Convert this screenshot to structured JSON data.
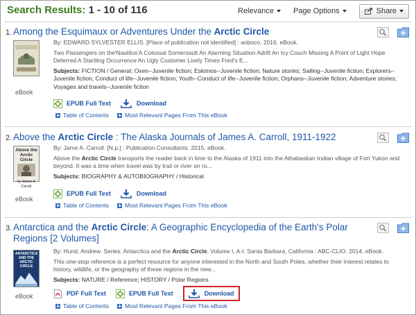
{
  "header": {
    "title_prefix": "Search Results:",
    "title_count": "1 - 10 of 116",
    "relevance_label": "Relevance",
    "page_options_label": "Page Options",
    "share_label": "Share"
  },
  "results": [
    {
      "number": "1.",
      "title_before": "Among the Esquimaux or Adventures Under the ",
      "title_bold": "Arctic Circle",
      "title_after": "",
      "byline": "By: EDWARD SYLVESTER ELLIS. [Place of publication not identified] : anboco. 2016. eBook.",
      "description": "Two Passengers on the'Nautilus'A Colossal Somersault An Alarming Situation Adrift An Icy Couch Missing A Point of Light Hope Deferred A Startling Occurrence An Ugly Customer Lively Times Fred's E...",
      "description_bold": "",
      "description_after": "",
      "subjects_label": "Subjects:",
      "subjects": "FICTION / General; Oxen--Juvenile fiction; Eskimos--Juvenile fiction; Nature stories; Sailing--Juvenile fiction; Explorers--Juvenile fiction; Conduct of life--Juvenile fiction; Youth--Conduct of life--Juvenile fiction; Orphans--Juvenile fiction; Adventure stories; Voyages and travels--Juvenile fiction",
      "cover_label": "eBook",
      "links": [
        "EPUB Full Text",
        "Download"
      ],
      "toc": [
        "Table of Contents",
        "Most Relevant Pages From This eBook"
      ]
    },
    {
      "number": "2.",
      "title_before": "Above the ",
      "title_bold": "Arctic Circle",
      "title_after": " : The Alaska Journals of James A. Carroll, 1911-1922",
      "byline": "By: Jame A. Carroll. [N.p.] : Publication Consultants. 2015. eBook.",
      "description": "Above the ",
      "description_bold": "Arctic Circle",
      "description_after": " transports the reader back in time to the Alaska of 1911 into the Athabaskan Indian village of Fort Yukon and beyond. It was a time when travel was by trail or river on ro...",
      "subjects_label": "Subjects:",
      "subjects": "BIOGRAPHY & AUTOBIOGRAPHY / Historical",
      "cover_label": "eBook",
      "cover_title": "Above the Arctic Circle",
      "cover_author": "by James A Carroll",
      "links": [
        "EPUB Full Text",
        "Download"
      ],
      "toc": [
        "Table of Contents",
        "Most Relevant Pages From This eBook"
      ]
    },
    {
      "number": "3.",
      "title_before": "Antarctica and the ",
      "title_bold": "Arctic Circle",
      "title_after": ": A Geographic Encyclopedia of the Earth's Polar Regions [2 Volumes]",
      "byline_before": "By: Hund, Andrew. Series: Antarctica and the ",
      "byline_bold": "Arctic Circle",
      "byline_after": ", Volume I, A-I. Santa Barbara, California : ABC-CLIO. 2014. eBook.",
      "description": "This one-stop reference is a perfect resource for anyone interested in the North and South Poles, whether their interest relates to history, wildlife, or the geography of these regions in the new...",
      "subjects_label": "Subjects:",
      "subjects": "NATURE / Reference; HISTORY / Polar Regions",
      "cover_label": "eBook",
      "cover_title": "ANTARCTICA AND THE ARCTIC CIRCLE",
      "links": [
        "PDF Full Text",
        "EPUB Full Text",
        "Download"
      ],
      "toc": [
        "Table of Contents",
        "Most Relevant Pages From This eBook"
      ]
    }
  ],
  "colors": {
    "title_green": "#3a7d1e",
    "link_blue": "#1f57a8",
    "highlight_red": "#d2232a"
  }
}
